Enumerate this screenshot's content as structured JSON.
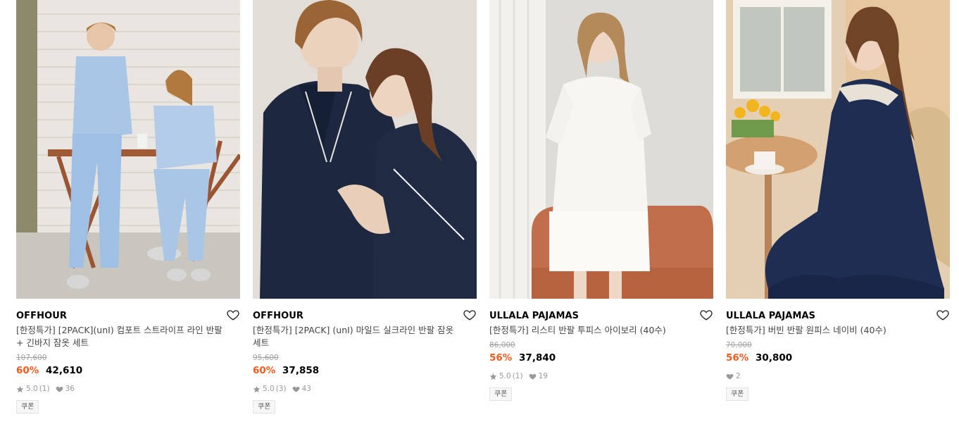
{
  "products": [
    {
      "brand": "OFFHOUR",
      "title": "[한정특가] [2PACK](unI) 컴포트 스트라이프 라인 반팔 + 긴바지 잠옷 세트",
      "original_price": "107,600",
      "discount": "60%",
      "price": "42,610",
      "rating": "5.0",
      "review_count": "(1)",
      "likes": "36",
      "badge": "쿠폰",
      "image_icon": "product-photo-couple-light-blue-pajamas"
    },
    {
      "brand": "OFFHOUR",
      "title": "[한정특가] [2PACK] (unI) 마일드 실크라인 반팔 잠옷 세트",
      "original_price": "95,600",
      "discount": "60%",
      "price": "37,858",
      "rating": "5.0",
      "review_count": "(3)",
      "likes": "43",
      "badge": "쿠폰",
      "image_icon": "product-photo-couple-navy-pajamas"
    },
    {
      "brand": "ULLALA PAJAMAS",
      "title": "[한정특가] 리스티 반팔 투피스 아이보리 (40수)",
      "original_price": "86,000",
      "discount": "56%",
      "price": "37,840",
      "rating": "5.0",
      "review_count": "(1)",
      "likes": "19",
      "badge": "쿠폰",
      "image_icon": "product-photo-ivory-two-piece"
    },
    {
      "brand": "ULLALA PAJAMAS",
      "title": "[한정특가] 버빈 반팔 원피스 네이비 (40수)",
      "original_price": "70,000",
      "discount": "56%",
      "price": "30,800",
      "rating": "",
      "review_count": "",
      "likes": "2",
      "badge": "쿠폰",
      "image_icon": "product-photo-navy-dress"
    }
  ],
  "colors": {
    "discount": "#f35b1c",
    "muted": "#999999",
    "strike": "#a0a0a0"
  }
}
